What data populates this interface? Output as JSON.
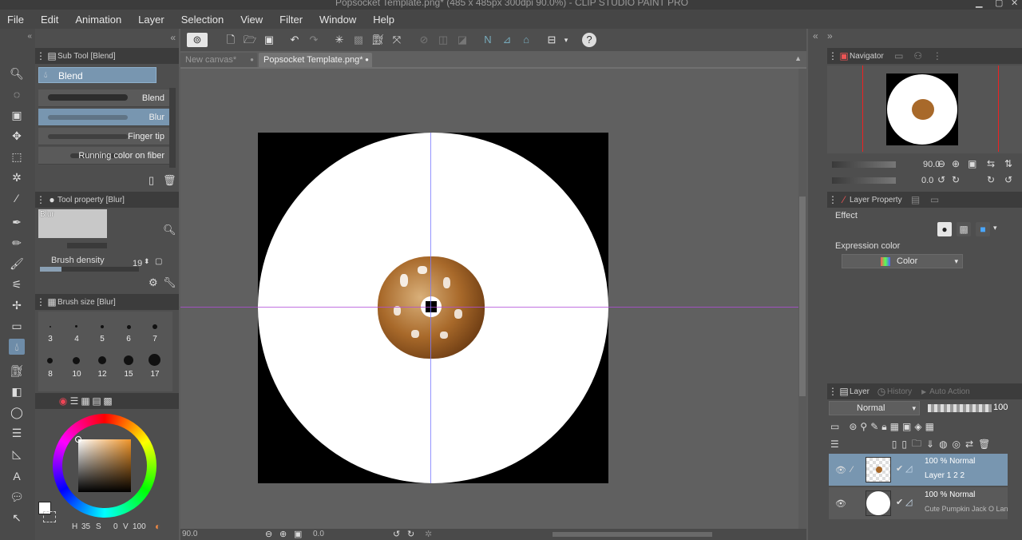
{
  "app": {
    "window_title": "Popsocket Template.png* (485 x 485px 300dpi 90.0%) - CLIP STUDIO PAINT PRO"
  },
  "menu": [
    "File",
    "Edit",
    "Animation",
    "Layer",
    "Selection",
    "View",
    "Filter",
    "Window",
    "Help"
  ],
  "document_tabs": [
    {
      "label": "New canvas*",
      "active": false
    },
    {
      "label": "Popsocket Template.png*",
      "active": true
    }
  ],
  "sub_tool": {
    "header": "Sub Tool [Blend]",
    "group": "Blend",
    "brushes": [
      "Blend",
      "Blur",
      "Finger tip",
      "Running color on fiber"
    ],
    "selected": "Blur"
  },
  "tool_property": {
    "header": "Tool property [Blur]",
    "preview_label": "Blur",
    "brush_density_label": "Brush density",
    "brush_density_value": "19"
  },
  "brush_size": {
    "header": "Brush size [Blur]",
    "row1": [
      "3",
      "4",
      "5",
      "6",
      "7"
    ],
    "row2": [
      "8",
      "10",
      "12",
      "15",
      "17"
    ]
  },
  "color": {
    "h": "35",
    "s": "0",
    "v": "100",
    "h_label": "H",
    "s_label": "S",
    "v_label": "V",
    "main_color": "#ffffff",
    "accent": "#6e8ca8"
  },
  "canvas_status": {
    "zoom": "90.0",
    "angle": "0.0"
  },
  "navigator": {
    "header": "Navigator",
    "zoom": "90.0",
    "rotation": "0.0"
  },
  "layer_property": {
    "header": "Layer Property",
    "effect_label": "Effect",
    "expression_color_label": "Expression color",
    "expression_color_value": "Color"
  },
  "layer_panel": {
    "tabs": [
      "Layer",
      "History",
      "Auto Action"
    ],
    "blend_mode": "Normal",
    "opacity": "100",
    "layers": [
      {
        "mode": "100 % Normal",
        "name": "Layer 1 2 2",
        "selected": true
      },
      {
        "mode": "100 % Normal",
        "name": "Cute Pumpkin Jack O Lantern",
        "selected": false
      }
    ]
  }
}
